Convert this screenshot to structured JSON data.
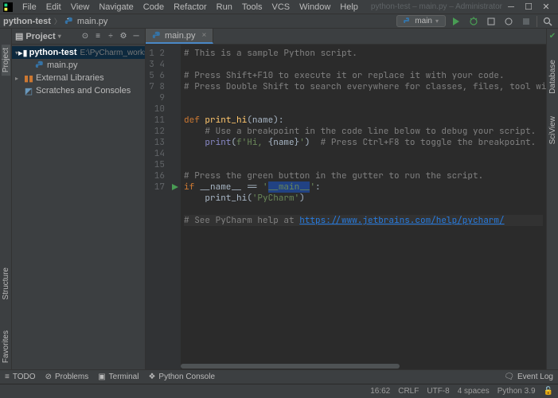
{
  "titlebar": {
    "menus": [
      "File",
      "Edit",
      "View",
      "Navigate",
      "Code",
      "Refactor",
      "Run",
      "Tools",
      "VCS",
      "Window",
      "Help"
    ],
    "title": "python-test – main.py – Administrator"
  },
  "nav": {
    "project": "python-test",
    "file": "main.py",
    "run_config": "main"
  },
  "sidebar": {
    "header": "Project",
    "root": {
      "name": "python-test",
      "path": "E:\\PyCharm_workspace\\python-test"
    },
    "file": "main.py",
    "external": "External Libraries",
    "scratches": "Scratches and Consoles"
  },
  "left_tabs": {
    "project": "Project",
    "structure": "Structure",
    "favorites": "Favorites"
  },
  "right_tabs": {
    "database": "Database",
    "sciview": "SciView"
  },
  "editor": {
    "tab": "main.py",
    "lines": [
      "# This is a sample Python script.",
      "",
      "# Press Shift+F10 to execute it or replace it with your code.",
      "# Press Double Shift to search everywhere for classes, files, tool windows, actions,",
      "",
      "",
      "def print_hi(name):",
      "    # Use a breakpoint in the code line below to debug your script.",
      "    print(f'Hi, {name}')  # Press Ctrl+F8 to toggle the breakpoint.",
      "",
      "",
      "# Press the green button in the gutter to run the script.",
      "if __name__ == '__main__':",
      "    print_hi('PyCharm')",
      "",
      "# See PyCharm help at https://www.jetbrains.com/help/pycharm/",
      ""
    ],
    "line_count": 17
  },
  "bottom": {
    "todo": "TODO",
    "problems": "Problems",
    "terminal": "Terminal",
    "console": "Python Console",
    "eventlog": "Event Log"
  },
  "status": {
    "pos": "16:62",
    "eol": "CRLF",
    "enc": "UTF-8",
    "indent": "4 spaces",
    "python": "Python 3.9"
  }
}
